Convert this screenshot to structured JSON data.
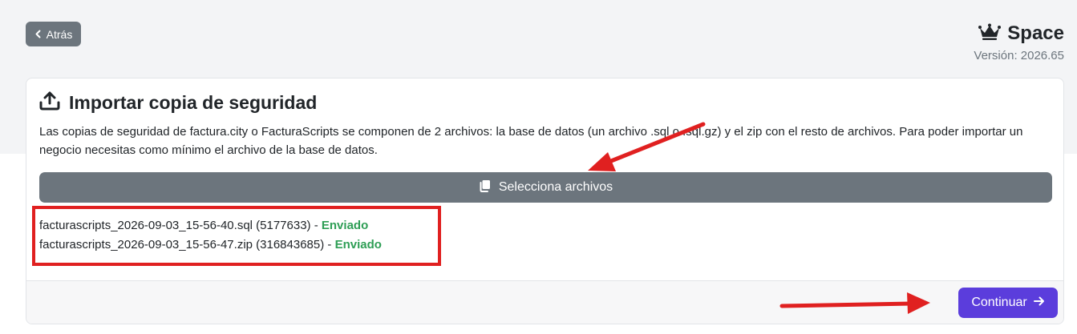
{
  "header": {
    "back_label": "Atrás",
    "brand_name": "Space",
    "version": "Versión: 2026.65"
  },
  "import_card": {
    "title": "Importar copia de seguridad",
    "description": "Las copias de seguridad de factura.city o FacturaScripts se componen de 2 archivos: la base de datos (un archivo .sql o .sql.gz) y el zip con el resto de archivos. Para poder importar un negocio necesitas como mínimo el archivo de la base de datos.",
    "select_label": "Selecciona archivos",
    "files": [
      {
        "name": "facturascripts_2026-09-03_15-56-40.sql (5177633) - ",
        "status": "Enviado"
      },
      {
        "name": "facturascripts_2026-09-03_15-56-47.zip (316843685) - ",
        "status": "Enviado"
      }
    ],
    "continue_label": "Continuar"
  },
  "colors": {
    "primary": "#5b3ddc",
    "secondary": "#6c757d",
    "success": "#2e9e55",
    "annotation": "#e02020"
  },
  "icons": {
    "back": "chevron-left-icon",
    "brand": "crown-icon",
    "title": "upload-icon",
    "select": "copy-files-icon",
    "continue": "arrow-right-icon"
  }
}
